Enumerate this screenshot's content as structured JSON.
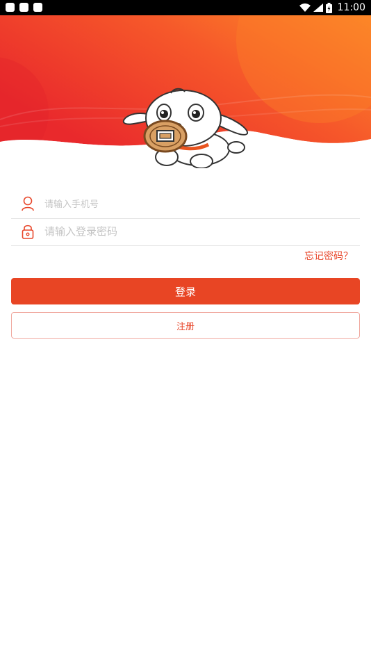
{
  "status_bar": {
    "time": "11:00",
    "icons": [
      "notification-icon",
      "notification-icon",
      "notification-icon",
      "wifi-icon",
      "signal-icon",
      "battery-icon"
    ]
  },
  "header": {
    "mascot": "dog-mascot-holding-coin",
    "colors": {
      "gradient_start": "#ea2d2c",
      "gradient_end": "#fd8f27"
    }
  },
  "login_form": {
    "phone": {
      "placeholder": "请输入手机号",
      "value": "",
      "icon": "user-icon"
    },
    "password": {
      "placeholder": "请输入登录密码",
      "value": "",
      "icon": "lock-icon"
    },
    "forgot_label": "忘记密码？",
    "login_label": "登录",
    "register_label": "注册"
  },
  "colors": {
    "accent": "#e84524",
    "divider": "#e2e2e2",
    "register_border": "#f0a9a0"
  }
}
